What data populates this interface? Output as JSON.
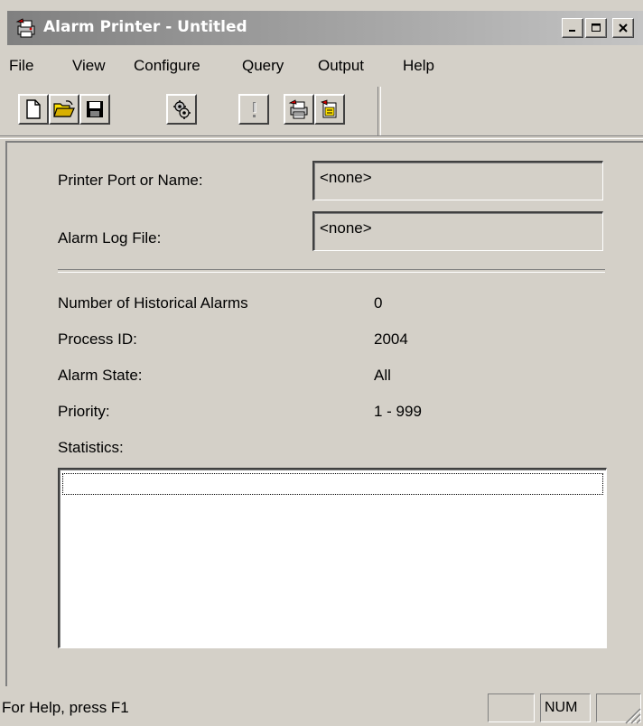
{
  "window": {
    "title": "Alarm Printer - Untitled",
    "app_icon": "alarm-printer-icon",
    "caption_buttons": [
      "minimize-icon",
      "maximize-icon",
      "close-icon"
    ]
  },
  "menu": {
    "items": [
      "File",
      "View",
      "Configure",
      "Query",
      "Output",
      "Help"
    ]
  },
  "toolbar": {
    "buttons": [
      {
        "icon": "new-document-icon"
      },
      {
        "icon": "open-folder-icon"
      },
      {
        "icon": "save-disk-icon"
      },
      {
        "icon": "configure-gear-icon"
      },
      {
        "icon": "exclamation-icon",
        "disabled": true
      },
      {
        "icon": "print-alarm-icon"
      },
      {
        "icon": "edit-alarm-icon"
      }
    ]
  },
  "form": {
    "printer_port_label": "Printer Port or Name:",
    "printer_port_value": "<none>",
    "alarm_log_label": "Alarm Log File:",
    "alarm_log_value": "<none>"
  },
  "info": {
    "historical_label": "Number of Historical Alarms",
    "historical_value": "0",
    "process_id_label": "Process ID:",
    "process_id_value": "2004",
    "alarm_state_label": "Alarm State:",
    "alarm_state_value": "All",
    "priority_label": "Priority:",
    "priority_value": "1 - 999",
    "statistics_label": "Statistics:"
  },
  "statistics": {
    "rows": []
  },
  "statusbar": {
    "help_text": "For Help, press F1",
    "pane_1": "",
    "pane_num": "NUM",
    "pane_3": ""
  }
}
